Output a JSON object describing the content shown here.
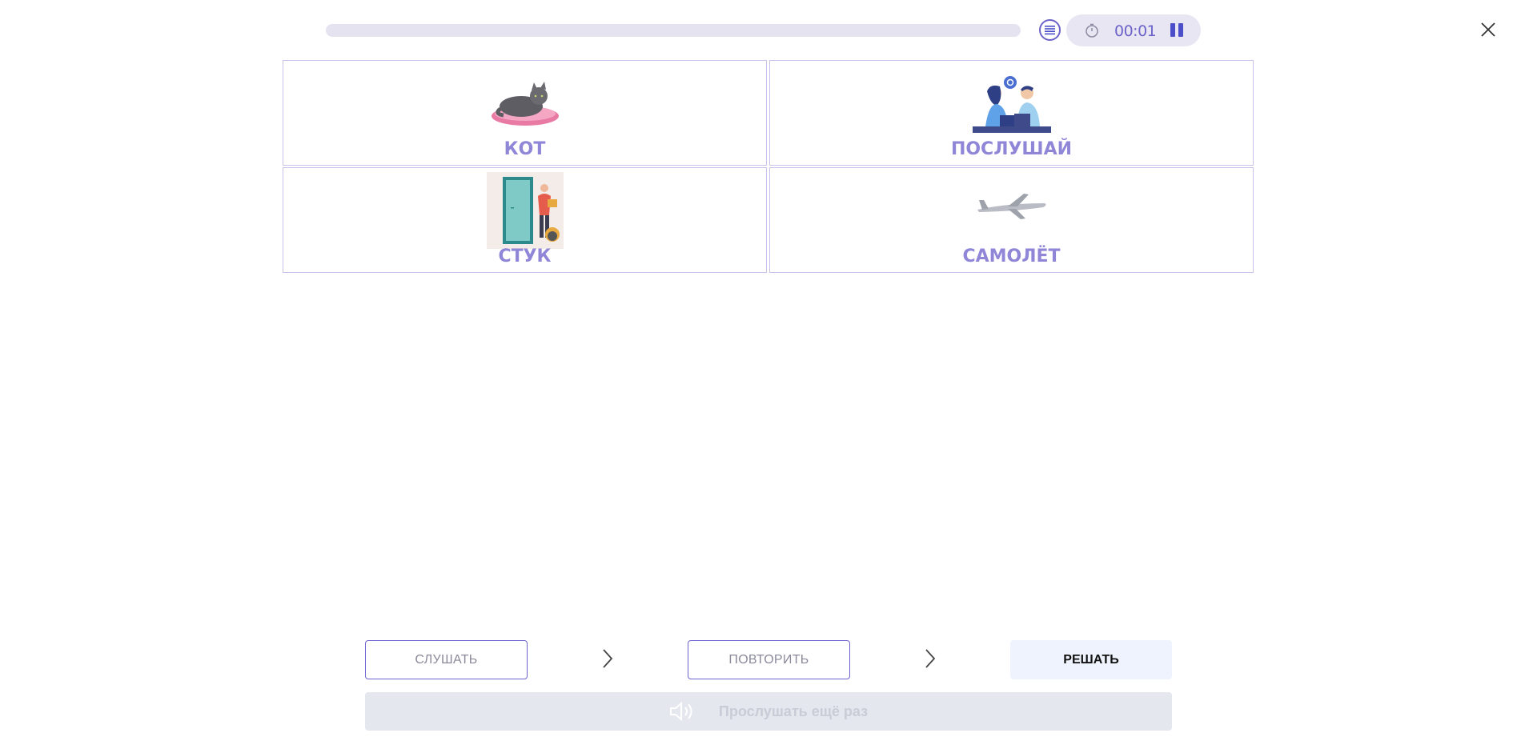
{
  "header": {
    "progress_fraction": 0,
    "timer": "00:01",
    "icons": {
      "list": "list-icon",
      "timer": "stopwatch-icon",
      "pause": "pause-icon",
      "close": "close-icon"
    }
  },
  "cards": [
    {
      "label": "КОТ",
      "icon": "cat-image"
    },
    {
      "label": "ПОСЛУШАЙ",
      "icon": "people-talking-image"
    },
    {
      "label": "СТУК",
      "icon": "door-knock-image"
    },
    {
      "label": "САМОЛЁТ",
      "icon": "airplane-image"
    }
  ],
  "controls": {
    "listen_label": "СЛУШАТЬ",
    "repeat_label": "ПОВТОРИТЬ",
    "solve_label": "РЕШАТЬ",
    "replay_label": "Прослушать ещё раз"
  },
  "colors": {
    "accent": "#6c63c9",
    "card_label": "#8f86d8",
    "card_border": "#c9c3ec",
    "solve_bg": "#eef3fd",
    "replay_bg": "#e4e7ee"
  }
}
